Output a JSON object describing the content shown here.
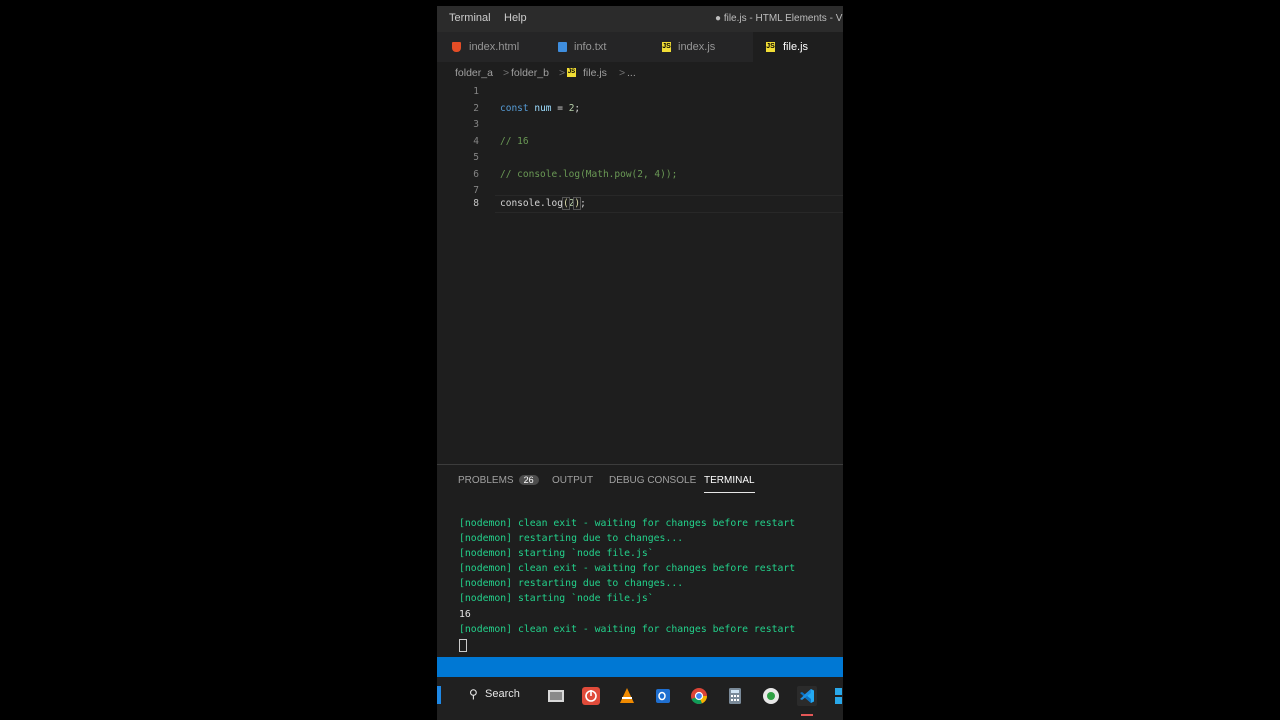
{
  "titlebar": {
    "menu": [
      "Terminal",
      "Help"
    ],
    "title": "● file.js - HTML Elements - V"
  },
  "tabs": [
    {
      "label": "index.html",
      "icon": "html-file-icon",
      "color": "#e44d26",
      "active": false
    },
    {
      "label": "info.txt",
      "icon": "text-file-icon",
      "color": "#3f8ede",
      "active": false
    },
    {
      "label": "index.js",
      "icon": "js-file-icon",
      "color": "#f1dd35",
      "active": false
    },
    {
      "label": "file.js",
      "icon": "js-file-icon",
      "color": "#f1dd35",
      "active": true
    }
  ],
  "breadcrumb": {
    "items": [
      "folder_a",
      "folder_b",
      "file.js",
      "..."
    ],
    "separator": ">"
  },
  "editor": {
    "line_numbers": [
      "1",
      "2",
      "3",
      "4",
      "5",
      "6",
      "7",
      "8"
    ],
    "current_line": "8",
    "lines": {
      "l2": {
        "kw": "const",
        "sp1": " ",
        "var": "num",
        "op": " = ",
        "num": "2",
        "end": ";"
      },
      "l4": {
        "cmt": "// 16"
      },
      "l6": {
        "cmt": "// console.log(Math.pow(2, 4));"
      },
      "l8": {
        "obj": "console",
        "dot": ".",
        "fn": "log",
        "open": "(",
        "num": "2",
        "close": ")",
        "end": ";"
      }
    }
  },
  "panel": {
    "tabs": {
      "problems": "PROBLEMS",
      "problems_count": "26",
      "output": "OUTPUT",
      "debug": "DEBUG CONSOLE",
      "terminal": "TERMINAL"
    },
    "terminal_lines": [
      "[nodemon] clean exit - waiting for changes before restart",
      "[nodemon] restarting due to changes...",
      "[nodemon] starting `node file.js`",
      "[nodemon] clean exit - waiting for changes before restart",
      "[nodemon] restarting due to changes...",
      "[nodemon] starting `node file.js`",
      "16",
      "[nodemon] clean exit - waiting for changes before restart"
    ]
  },
  "taskbar": {
    "search_label": "Search",
    "icons": [
      "file-explorer-icon",
      "power-app-icon",
      "vlc-icon",
      "outlook-icon",
      "chrome-icon",
      "calculator-icon",
      "chat-app-icon",
      "vscode-icon",
      "windows-icon"
    ]
  },
  "colors": {
    "accent": "#0078d4",
    "terminal_green": "#23d18b",
    "keyword": "#569cd6",
    "comment": "#6a9955"
  }
}
